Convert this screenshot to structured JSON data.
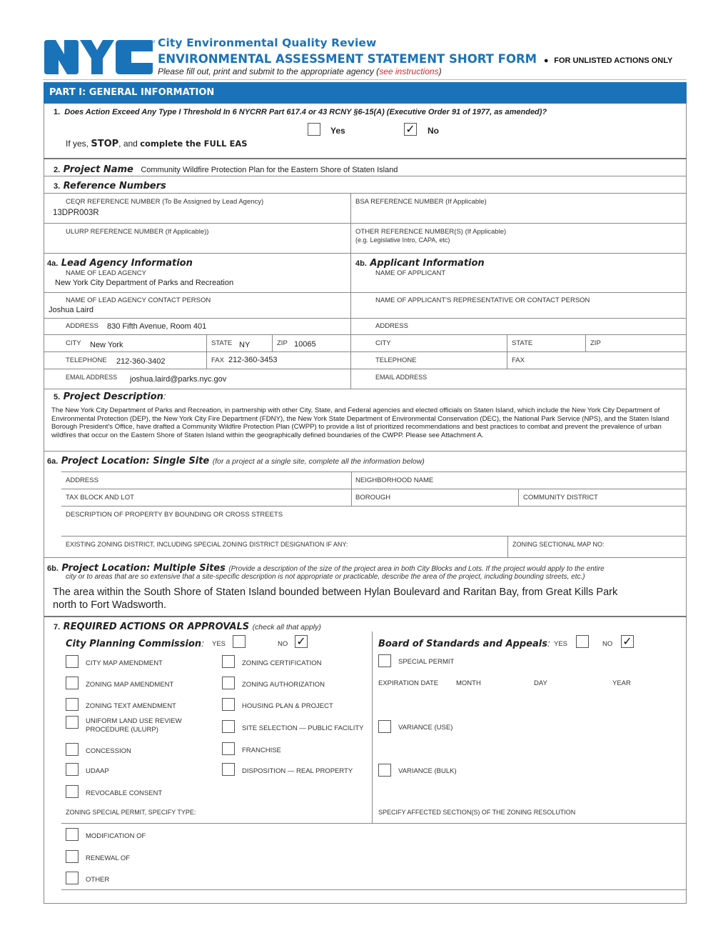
{
  "header": {
    "logo_text": "NYC",
    "trademark": "TM",
    "title": "City Environmental Quality Review",
    "form_title": "ENVIRONMENTAL ASSESSMENT STATEMENT SHORT FORM",
    "bullet": "●",
    "form_scope": "FOR UNLISTED ACTIONS ONLY",
    "instructions_prefix": "Please fill out, print and submit to the appropriate agency (",
    "instructions_link": "see instructions",
    "instructions_suffix": ")",
    "brand_color": "#1a73b8",
    "link_color": "#d9282f"
  },
  "part1": {
    "title": "PART I: GENERAL INFORMATION",
    "q1": {
      "number": "1.",
      "question": "Does Action Exceed Any Type I Threshold In 6 NYCRR Part 617.4 or 43 RCNY §6-15(A) (Executive Order 91 of 1977, as amended)?",
      "yes_label": "Yes",
      "no_label": "No",
      "yes_checked": false,
      "no_checked": true,
      "check_glyph": "✓",
      "stop_prefix": "If yes, ",
      "stop_word": "STOP",
      "stop_mid": ", and ",
      "stop_action": "complete the FULL EAS"
    },
    "q2": {
      "number": "2.",
      "label": "Project Name",
      "value": "Community Wildfire Protection Plan for the Eastern Shore of Staten Island"
    },
    "q3": {
      "number": "3.",
      "label": "Reference Numbers",
      "ceqr_label": "CEQR REFERENCE NUMBER (To Be Assigned by Lead Agency)",
      "ceqr_value": "13DPR003R",
      "bsa_label": "BSA REFERENCE NUMBER (If Applicable)",
      "bsa_value": "",
      "ulurp_label": "ULURP REFERENCE NUMBER  (If Applicable))",
      "ulurp_value": "",
      "other_label": "OTHER REFERENCE NUMBER(S) (If Applicable)",
      "other_hint": "(e.g. Legislative Intro, CAPA, etc)",
      "other_value": ""
    },
    "q4a": {
      "number": "4a.",
      "label": "Lead Agency Information",
      "name_label": "NAME OF LEAD AGENCY",
      "name_value": "New York City Department of Parks and Recreation",
      "contact_label": "NAME OF LEAD AGENCY CONTACT PERSON",
      "contact_value": "Joshua Laird",
      "address_label": "ADDRESS",
      "address_value": "830 Fifth Avenue, Room 401",
      "city_label": "CITY",
      "city_value": "New York",
      "state_label": "STATE",
      "state_value": "NY",
      "zip_label": "ZIP",
      "zip_value": "10065",
      "telephone_label": "TELEPHONE",
      "telephone_value": "212-360-3402",
      "fax_label": "FAX",
      "fax_value": "212-360-3453",
      "email_label": "EMAIL ADDRESS",
      "email_value": "joshua.laird@parks.nyc.gov"
    },
    "q4b": {
      "number": "4b.",
      "label": "Applicant Information",
      "name_label": "NAME OF APPLICANT",
      "contact_label": "NAME OF APPLICANT'S REPRESENTATIVE OR CONTACT PERSON",
      "address_label": "ADDRESS",
      "city_label": "CITY",
      "state_label": "STATE",
      "zip_label": "ZIP",
      "telephone_label": "TELEPHONE",
      "fax_label": "FAX",
      "email_label": "EMAIL ADDRESS"
    },
    "q5": {
      "number": "5.",
      "label": "Project Description",
      "colon": ":",
      "value": "The New York City Department of Parks and Recreation, in partnership with other City, State, and Federal agencies and elected officials on Staten Island, which include  the New York City Department of Environmental Protection (DEP), the New York City Fire Department (FDNY), the New York State Department of Environmental Conservation (DEC), the National Park Service (NPS), and the Staten Island Borough President's Office, have drafted a Community Wildfire Protection Plan (CWPP) to provide a list of prioritized recommendations and best practices to combat and prevent the prevalence of urban wildfires that occur on the Eastern Shore of Staten Island within the geographically defined boundaries of the CWPP.  Please see Attachment A."
    },
    "q6a": {
      "number": "6a.",
      "label_a": "Project Location",
      "label_b": ": Single Site",
      "hint": "(for a project at a single site, complete all the information below)",
      "address_label": "ADDRESS",
      "neighborhood_label": "NEIGHBORHOOD NAME",
      "tax_label": "TAX BLOCK AND LOT",
      "borough_label": "BOROUGH",
      "community_label": "COMMUNITY DISTRICT",
      "description_label": "DESCRIPTION OF PROPERTY BY BOUNDING OR CROSS STREETS",
      "zoning_label": "EXISTING ZONING DISTRICT, INCLUDING SPECIAL ZONING DISTRICT DESIGNATION IF ANY:",
      "sectional_label": "ZONING SECTIONAL MAP NO:"
    },
    "q6b": {
      "number": "6b.",
      "label_a": "Project Location",
      "label_b": ": Multiple Sites",
      "hint_line1": "(Provide a description of the size of the project area in both City Blocks and Lots. If the project would apply to the entire",
      "hint_line2": "city or to areas that are so extensive that a site-specific description is not appropriate or practicable, describe the area of the project, including bounding streets, etc.)",
      "value_line1": "The area within the South Shore of Staten Island bounded between Hylan Boulevard and Raritan Bay, from Great Kills Park",
      "value_line2": "north to Fort Wadsworth."
    },
    "q7": {
      "number": "7.",
      "label": "REQUIRED ACTIONS OR APPROVALS",
      "hint": "(check all that apply)",
      "cpc": {
        "label": "City Planning Commission",
        "colon": ":",
        "yes_label": "YES",
        "no_label": "NO",
        "yes_checked": false,
        "no_checked": true
      },
      "bsa": {
        "label": "Board of Standards and Appeals",
        "colon": ":",
        "yes_label": "YES",
        "no_label": "NO",
        "yes_checked": false,
        "no_checked": true
      },
      "cpc_col1": [
        {
          "label": "CITY MAP AMENDMENT",
          "checked": false
        },
        {
          "label": "ZONING MAP AMENDMENT",
          "checked": false
        },
        {
          "label": "ZONING TEXT AMENDMENT",
          "checked": false
        },
        {
          "label": "UNIFORM LAND USE REVIEW",
          "label2": "PROCEDURE (ULURP)",
          "checked": false
        },
        {
          "label": "CONCESSION",
          "checked": false
        },
        {
          "label": "UDAAP",
          "checked": false
        },
        {
          "label": "REVOCABLE CONSENT",
          "checked": false
        }
      ],
      "cpc_col2": [
        {
          "label": "ZONING CERTIFICATION",
          "checked": false
        },
        {
          "label": "ZONING AUTHORIZATION",
          "checked": false
        },
        {
          "label": "HOUSING PLAN & PROJECT",
          "checked": false
        },
        {
          "label": "SITE SELECTION — PUBLIC FACILITY",
          "checked": false
        },
        {
          "label": "FRANCHISE",
          "checked": false
        },
        {
          "label": "DISPOSITION — REAL PROPERTY",
          "checked": false
        }
      ],
      "bsa_items": {
        "special_permit": {
          "label": "SPECIAL PERMIT",
          "checked": false
        },
        "expiration_label": "EXPIRATION DATE",
        "month_label": "MONTH",
        "day_label": "DAY",
        "year_label": "YEAR",
        "variance_use": {
          "label": "VARIANCE (USE)",
          "checked": false
        },
        "variance_bulk": {
          "label": "VARIANCE (BULK)",
          "checked": false
        }
      },
      "zoning_special_label": "ZONING SPECIAL PERMIT, SPECIFY TYPE:",
      "affected_sections_label": "SPECIFY AFFECTED SECTION(S) OF THE ZONING RESOLUTION",
      "permit_types": [
        {
          "label": "MODIFICATION OF",
          "checked": false
        },
        {
          "label": "RENEWAL  OF",
          "checked": false
        },
        {
          "label": "OTHER",
          "checked": false
        }
      ]
    }
  }
}
